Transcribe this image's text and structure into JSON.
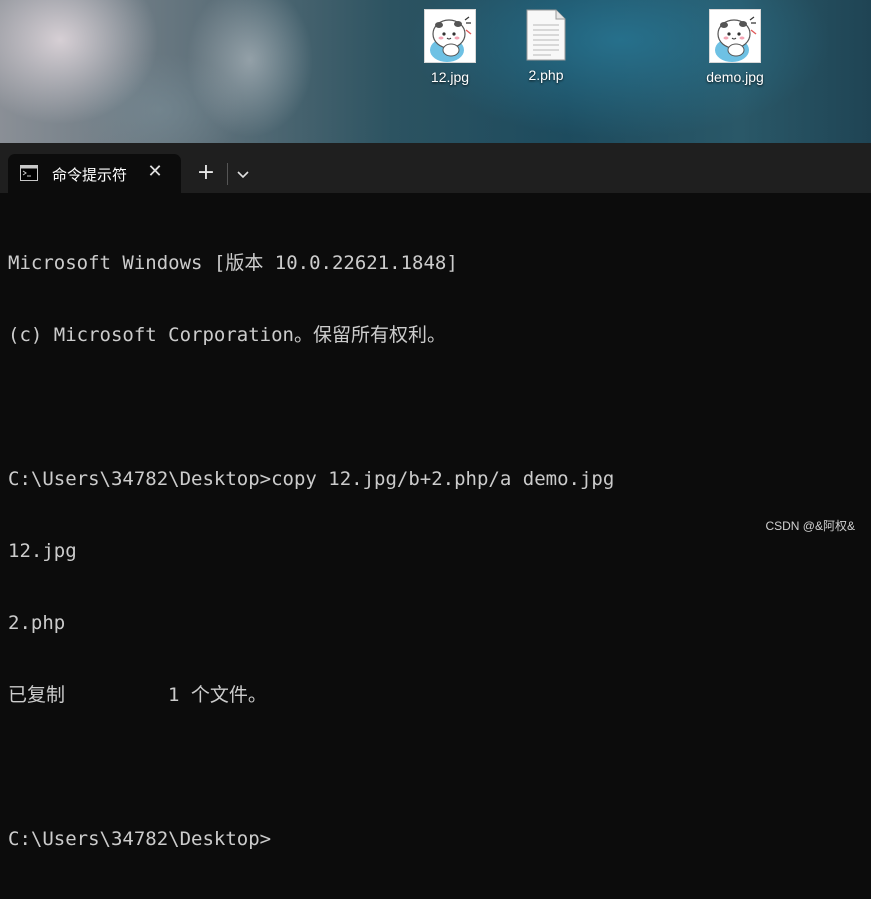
{
  "desktop": {
    "icons": [
      {
        "label": "12.jpg",
        "type": "image"
      },
      {
        "label": "2.php",
        "type": "document"
      },
      {
        "label": "demo.jpg",
        "type": "image"
      }
    ]
  },
  "terminal": {
    "tab_title": "命令提示符",
    "tab_icon": "cmd-icon",
    "new_tab_label": "+",
    "lines": [
      "Microsoft Windows [版本 10.0.22621.1848]",
      "(c) Microsoft Corporation。保留所有权利。",
      "",
      "C:\\Users\\34782\\Desktop>copy 12.jpg/b+2.php/a demo.jpg",
      "12.jpg",
      "2.php",
      "已复制         1 个文件。",
      "",
      "C:\\Users\\34782\\Desktop>"
    ]
  },
  "watermark": "CSDN @&阿权&",
  "colors": {
    "console_bg": "#0c0c0c",
    "console_text": "#cccccc",
    "tabbar_bg": "#1f1f1f"
  }
}
